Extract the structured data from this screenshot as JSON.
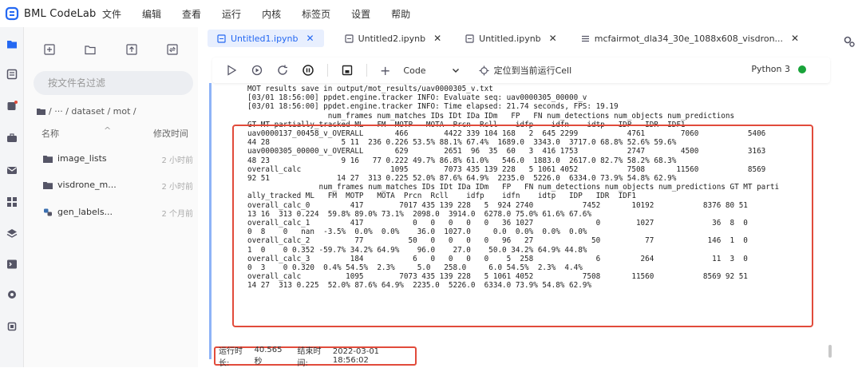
{
  "app": {
    "title": "BML CodeLab"
  },
  "menu": [
    "文件",
    "编辑",
    "查看",
    "运行",
    "内核",
    "标签页",
    "设置",
    "帮助"
  ],
  "file_panel": {
    "search_placeholder": "按文件名过滤",
    "breadcrumb": "/ ··· / dataset / mot /",
    "col_name": "名称",
    "col_time": "修改时间",
    "items": [
      {
        "name": "image_lists",
        "time": "2 小时前",
        "icon": "folder-icon"
      },
      {
        "name": "visdrone_m...",
        "time": "2 小时前",
        "icon": "folder-icon"
      },
      {
        "name": "gen_labels...",
        "time": "2 个月前",
        "icon": "python-file-icon"
      }
    ]
  },
  "tabs": [
    {
      "label": "Untitled1.ipynb",
      "active": true
    },
    {
      "label": "Untitled2.ipynb",
      "active": false
    },
    {
      "label": "Untitled.ipynb",
      "active": false
    },
    {
      "label": "mcfairmot_dla34_30e_1088x608_visdron...",
      "active": false
    }
  ],
  "toolbar": {
    "cell_type": "Code",
    "locate_label": "定位到当前运行Cell",
    "kernel": "Python 3"
  },
  "output_lines": [
    "MOT results save in output/mot_results/uav0000305_v.txt",
    "[03/01 18:56:00] ppdet.engine.tracker INFO: Evaluate seq: uav0000305_00000_v",
    "[03/01 18:56:00] ppdet.engine.tracker INFO: Time elapsed: 21.74 seconds, FPS: 19.19",
    "                  num_frames num_matches IDs IDt IDa IDm   FP   FN num_detections num_objects num_predictions",
    "GT MT partially_tracked ML   FM  MOTP   MOTA  Prcn  Rcll    idfp    idfn    idtp   IDP   IDR  IDF1",
    "uav0000137_00458_v_OVERALL       466        4422 339 104 168   2  645 2299           4761        7060           5406",
    "44 28                5 11  236 0.226 53.5% 88.1% 67.4%  1689.0  3343.0  3717.0 68.8% 52.6% 59.6%",
    "uav0000305_00000_v_OVERALL       629        2651  96  35  60   3  416 1753           2747        4500           3163",
    "48 23                9 16   77 0.222 49.7% 86.8% 61.0%   546.0  1883.0  2617.0 82.7% 58.2% 68.3%",
    "overall_calc                    1095        7073 435 139 228   5 1061 4052           7508       11560           8569",
    "92 51               14 27  313 0.225 52.0% 87.6% 64.9%  2235.0  5226.0  6334.0 73.9% 54.8% 62.9%",
    "                num_frames num_matches IDs IDt IDa IDm   FP   FN num_detections num_objects num_predictions GT MT parti",
    "ally_tracked ML   FM  MOTP   MOTA  Prcn  Rcll    idfp    idfn    idtp   IDP   IDR  IDF1",
    "overall_calc_0         417        7017 435 139 228   5  924 2740           7452       10192           8376 80 51",
    "13 16  313 0.224  59.8% 89.0% 73.1%  2098.0  3914.0  6278.0 75.0% 61.6% 67.6%",
    "overall_calc_1         417           0   0   0   0   0   36 1027              0        1027             36  8  0",
    "0  8    0   nan  -3.5%  0.0%  0.0%    36.0  1027.0     0.0  0.0%  0.0%  0.0%",
    "overall_calc_2          77          50   0   0   0   0   96   27             50          77            146  1  0",
    "1  0    0 0.352 -59.7% 34.2% 64.9%    96.0    27.0    50.0 34.2% 64.9% 44.8%",
    "overall_calc_3         184           6   0   0   0   0    5  258              6         264             11  3  0",
    "0  3    0 0.320  0.4% 54.5%  2.3%     5.0   258.0     6.0 54.5%  2.3%  4.4%",
    "overall_calc          1095        7073 435 139 228   5 1061 4052           7508       11560           8569 92 51",
    "14 27  313 0.225  52.0% 87.6% 64.9%  2235.0  5226.0  6334.0 73.9% 54.8% 62.9%"
  ],
  "exec": {
    "duration_label": "运行时长:",
    "duration": "40.565秒",
    "end_label": "结束时间:",
    "end_time": "2022-03-01 18:56:02"
  },
  "colors": {
    "accent": "#2468f2",
    "highlight": "#e14b3b",
    "kernel_status": "#19a33a"
  }
}
